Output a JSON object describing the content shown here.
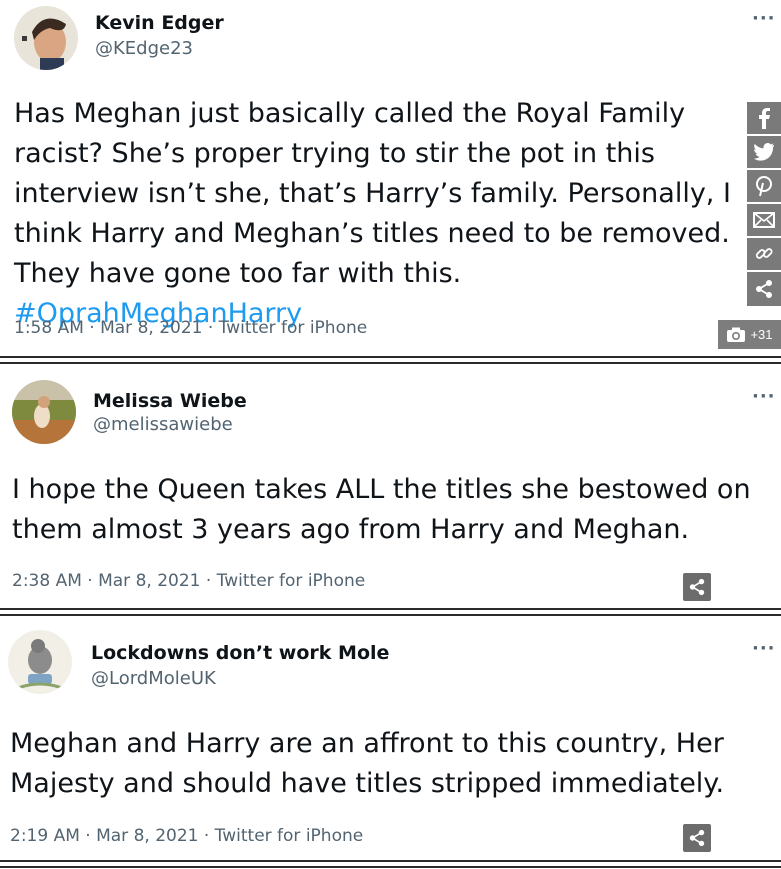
{
  "tweets": [
    {
      "name": "Kevin Edger",
      "handle": "@KEdge23",
      "text": "Has Meghan just basically called the Royal Family racist? She’s proper trying to stir the pot in this interview isn’t she, that’s Harry’s family. Personally, I think Harry and Meghan’s titles need to be removed. They have gone too far with this.",
      "hashtag": "#OprahMeghanHarry",
      "meta": "1:58 AM · Mar 8, 2021 · Twitter for iPhone",
      "more": "···"
    },
    {
      "name": "Melissa Wiebe",
      "handle": "@melissawiebe",
      "text": "I hope the Queen takes ALL the titles she bestowed on them almost 3 years ago from Harry and Meghan.",
      "meta": "2:38 AM · Mar 8, 2021 · Twitter for iPhone",
      "more": "···"
    },
    {
      "name": "Lockdowns don’t work Mole",
      "handle": "@LordMoleUK",
      "text": "Meghan and Harry are an affront to this country, Her Majesty and should have titles stripped immediately.",
      "meta": "2:19 AM · Mar 8, 2021 · Twitter for iPhone",
      "more": "···"
    }
  ],
  "social_bar": {
    "icons": [
      "facebook-icon",
      "twitter-icon",
      "pinterest-icon",
      "email-icon",
      "link-icon",
      "share-icon"
    ]
  },
  "gallery": {
    "count": "+31",
    "icon": "camera-icon"
  },
  "colors": {
    "hashtag": "#1d9bf0",
    "muted": "#536471",
    "share_bg": "#6c6c6c"
  }
}
